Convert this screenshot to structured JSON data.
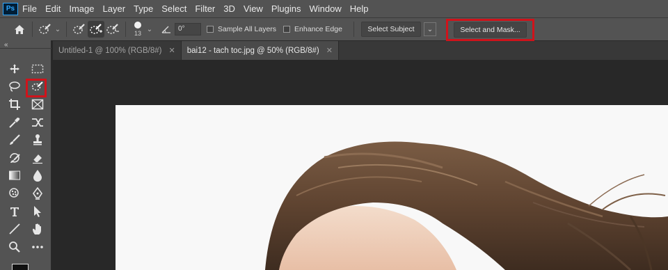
{
  "menu": {
    "logo": "Ps",
    "items": [
      "File",
      "Edit",
      "Image",
      "Layer",
      "Type",
      "Select",
      "Filter",
      "3D",
      "View",
      "Plugins",
      "Window",
      "Help"
    ]
  },
  "options": {
    "brush_size": "13",
    "angle": "0°",
    "sample_all_layers": "Sample All Layers",
    "enhance_edge": "Enhance Edge",
    "select_subject": "Select Subject",
    "select_and_mask": "Select and Mask..."
  },
  "tabs": [
    {
      "label": "Untitled-1 @ 100% (RGB/8#)",
      "active": false
    },
    {
      "label": "bai12 - tach toc.jpg @ 50% (RGB/8#)",
      "active": true
    }
  ],
  "toolbar": {
    "collapse": "«",
    "tools": [
      "move-icon",
      "rect-marquee-icon",
      "lasso-icon",
      "quick-selection-icon",
      "crop-icon",
      "frame-icon",
      "eyedropper-icon",
      "healing-icon",
      "brush-icon",
      "stamp-icon",
      "history-brush-icon",
      "eraser-icon",
      "gradient-icon",
      "blur-icon",
      "dodge-icon",
      "pen-icon",
      "type-icon",
      "path-select-icon",
      "line-icon",
      "hand-icon",
      "zoom-icon",
      "more-icon"
    ]
  },
  "colors": {
    "highlight": "#d0131b",
    "hair": "#6b4f3a",
    "skin": "#f1d3bf"
  }
}
